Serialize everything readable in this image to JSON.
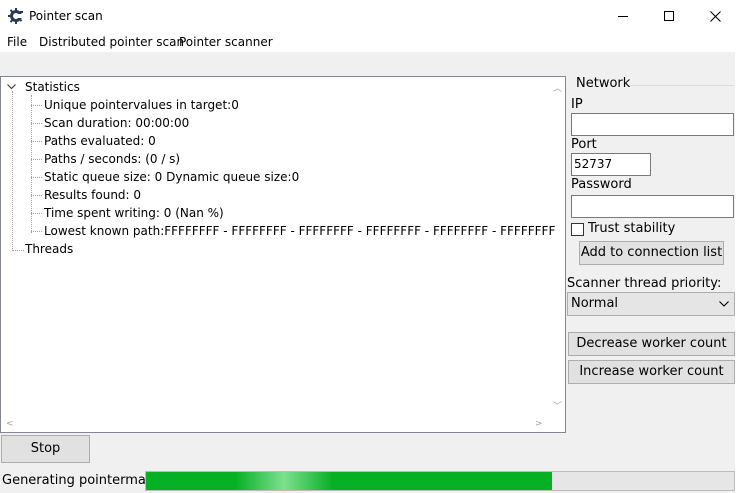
{
  "window": {
    "title": "Pointer scan",
    "controls": {
      "minimize": "—",
      "maximize": "☐",
      "close": "✕"
    }
  },
  "menu": [
    {
      "label": "File"
    },
    {
      "label": "Distributed pointer scan"
    },
    {
      "label": "Pointer scanner"
    }
  ],
  "tree": {
    "root": {
      "label": "Statistics",
      "expanded": true,
      "children": [
        "Unique pointervalues in target:0",
        "Scan duration: 00:00:00",
        "Paths evaluated: 0",
        "Paths / seconds: (0 / s)",
        "Static queue size: 0 Dynamic queue size:0",
        "Results found: 0",
        "Time spent writing: 0 (Nan %)",
        "Lowest known path:FFFFFFFF - FFFFFFFF - FFFFFFFF - FFFFFFFF - FFFFFFFF - FFFFFFFF"
      ]
    },
    "second": {
      "label": "Threads"
    }
  },
  "network": {
    "group_label": "Network",
    "ip_label": "IP",
    "ip_value": "",
    "port_label": "Port",
    "port_value": "52737",
    "password_label": "Password",
    "password_value": "",
    "trust_label": "Trust stability",
    "trust_checked": false,
    "add_button": "Add to connection list"
  },
  "scanner": {
    "priority_label": "Scanner thread priority:",
    "priority_value": "Normal",
    "decrease_button": "Decrease worker count",
    "increase_button": "Increase worker count"
  },
  "stop_button": "Stop",
  "status": {
    "text": "Generating pointermap",
    "progress_fraction": 0.69,
    "progress_color": "#06b025"
  }
}
